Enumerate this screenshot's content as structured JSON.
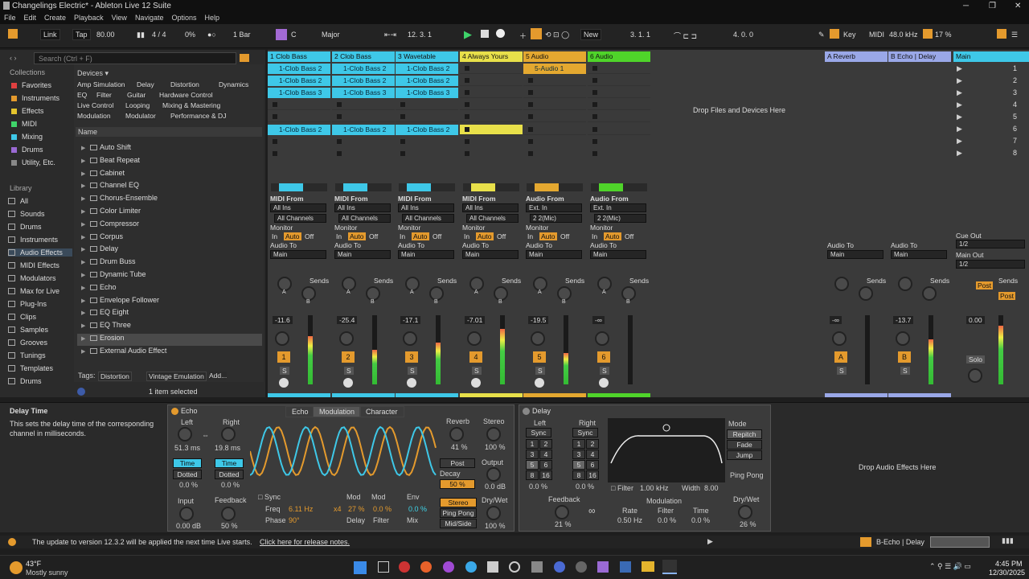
{
  "window": {
    "title": "Changelings Electric* - Ableton Live 12 Suite",
    "min": "─",
    "max": "❐",
    "close": "✕"
  },
  "menu": [
    "File",
    "Edit",
    "Create",
    "Playback",
    "View",
    "Navigate",
    "Options",
    "Help"
  ],
  "transport": {
    "link": "Link",
    "tap": "Tap",
    "tempo": "80.00",
    "sig": "4 / 4",
    "groove": "0%",
    "quant": "1 Bar",
    "key": "C",
    "scale": "Major",
    "position": "12.  3.  1",
    "new": "New",
    "loop_start": "3.  1.  1",
    "loop_len": "4.  0.  0",
    "key_btn": "Key",
    "midi_btn": "MIDI",
    "sample_rate": "48.0 kHz",
    "cpu": "17 %"
  },
  "browser": {
    "search_placeholder": "Search (Ctrl + F)",
    "collections_h": "Collections",
    "collections": [
      {
        "label": "Favorites",
        "color": "#e04040"
      },
      {
        "label": "Instruments",
        "color": "#e49a2d"
      },
      {
        "label": "Effects",
        "color": "#e4c42d"
      },
      {
        "label": "MIDI",
        "color": "#3fd46a"
      },
      {
        "label": "Mixing",
        "color": "#3ec8e8"
      },
      {
        "label": "Drums",
        "color": "#9a6ad4"
      },
      {
        "label": "Utility, Etc.",
        "color": "#888888"
      }
    ],
    "library_h": "Library",
    "library": [
      "All",
      "Sounds",
      "Drums",
      "Instruments",
      "Audio Effects",
      "MIDI Effects",
      "Modulators",
      "Max for Live",
      "Plug-Ins",
      "Clips",
      "Samples",
      "Grooves",
      "Tunings",
      "Templates",
      "Drums"
    ],
    "devices_h": "Devices",
    "device_tags": [
      "Amp Simulation",
      "Delay",
      "Distortion",
      "Dynamics",
      "EQ",
      "Filter",
      "Guitar",
      "Hardware Control",
      "Live Control",
      "Looping",
      "Mixing & Mastering",
      "Modulation",
      "Modulator",
      "Performance & DJ"
    ],
    "name_h": "Name",
    "files": [
      "Auto Shift",
      "Beat Repeat",
      "Cabinet",
      "Channel EQ",
      "Chorus-Ensemble",
      "Color Limiter",
      "Compressor",
      "Corpus",
      "Delay",
      "Drum Buss",
      "Dynamic Tube",
      "Echo",
      "Envelope Follower",
      "EQ Eight",
      "EQ Three",
      "Erosion",
      "External Audio Effect"
    ],
    "tags_label": "Tags:",
    "tags": [
      "Distortion",
      "Vintage Emulation",
      "Add..."
    ],
    "status": "1 item selected"
  },
  "tracks": [
    {
      "name": "1 Clob Bass",
      "color": "#3ec8e8",
      "clips": [
        "1-Clob Bass 2",
        "1-Clob Bass 2",
        "1-Clob Bass 3",
        "",
        "",
        "1-Clob Bass 2"
      ],
      "in_label": "MIDI From",
      "in1": "All Ins",
      "in2": "All Channels",
      "vol": "-11.6",
      "num": "1"
    },
    {
      "name": "2 Clob Bass",
      "color": "#3ec8e8",
      "clips": [
        "1-Clob Bass 2",
        "1-Clob Bass 2",
        "1-Clob Bass 3",
        "",
        "",
        "1-Clob Bass 2"
      ],
      "in_label": "MIDI From",
      "in1": "All Ins",
      "in2": "All Channels",
      "vol": "-25.4",
      "num": "2"
    },
    {
      "name": "3 Wavetable",
      "color": "#3ec8e8",
      "clips": [
        "1-Clob Bass 2",
        "1-Clob Bass 2",
        "1-Clob Bass 3",
        "",
        "",
        "1-Clob Bass 2"
      ],
      "in_label": "MIDI From",
      "in1": "All Ins",
      "in2": "All Channels",
      "vol": "-17.1",
      "num": "3"
    },
    {
      "name": "4 Always Yours",
      "color": "#e8e04a",
      "clips": [
        "",
        "",
        "",
        "",
        "",
        ""
      ],
      "in_label": "MIDI From",
      "in1": "All Ins",
      "in2": "All Channels",
      "vol": "-7.01",
      "num": "4"
    },
    {
      "name": "5 Audio",
      "color": "#e4a830",
      "clips": [
        "5-Audio 1",
        "",
        "",
        "",
        "",
        ""
      ],
      "in_label": "Audio From",
      "in1": "Ext. In",
      "in2": "2 2(Mic)",
      "vol": "-19.5",
      "num": "5"
    },
    {
      "name": "6 Audio",
      "color": "#4fd42a",
      "clips": [
        "",
        "",
        "",
        "",
        "",
        ""
      ],
      "in_label": "Audio From",
      "in1": "Ext. In",
      "in2": "2 2(Mic)",
      "vol": "-∞",
      "num": "6"
    }
  ],
  "mixer": {
    "monitor": "Monitor",
    "in": "In",
    "auto": "Auto",
    "off": "Off",
    "audio_to": "Audio To",
    "main": "Main",
    "sends": "Sends",
    "a": "A",
    "b": "B",
    "s": "S"
  },
  "drop_files": "Drop Files and Devices Here",
  "returns": [
    {
      "name": "A Reverb",
      "vol": "-∞",
      "num": "A"
    },
    {
      "name": "B Echo | Delay",
      "vol": "-13.7",
      "num": "B"
    }
  ],
  "master": {
    "name": "Main",
    "scenes": [
      "1",
      "2",
      "3",
      "4",
      "5",
      "6",
      "7",
      "8"
    ],
    "cue_out": "Cue Out",
    "cue_val": "1/2",
    "main_out": "Main Out",
    "main_val": "1/2",
    "vol": "0.00",
    "post": "Post",
    "solo": "Solo"
  },
  "info": {
    "title": "Delay Time",
    "text": "This sets the delay time of the corresponding channel in milliseconds."
  },
  "echo": {
    "title": "Echo",
    "left": "Left",
    "right": "Right",
    "left_ms": "51.3 ms",
    "right_ms": "19.8 ms",
    "time": "Time",
    "dotted": "Dotted",
    "zero": "0.0 %",
    "input": "Input",
    "input_val": "0.00 dB",
    "feedback": "Feedback",
    "fb_val": "50 %",
    "tabs": [
      "Echo",
      "Modulation",
      "Character"
    ],
    "sync": "Sync",
    "freq": "Freq",
    "freq_val": "6.11 Hz",
    "x4": "x4",
    "phase": "Phase",
    "phase_val": "90°",
    "mod": "Mod",
    "env": "Env",
    "mod1": "27 %",
    "mod2": "0.0 %",
    "env_val": "0.0 %",
    "delay": "Delay",
    "filter": "Filter",
    "mix": "Mix",
    "reverb": "Reverb",
    "reverb_val": "41 %",
    "stereo": "Stereo",
    "stereo_val": "100 %",
    "post": "Post",
    "decay": "Decay",
    "decay_val": "50 %",
    "output": "Output",
    "output_val": "0.0 dB",
    "stereo_btn": "Stereo",
    "pingpong": "Ping Pong",
    "midside": "Mid/Side",
    "drywet": "Dry/Wet",
    "drywet_val": "100 %"
  },
  "delay": {
    "title": "Delay",
    "left": "Left",
    "right": "Right",
    "sync": "Sync",
    "grid": [
      "1",
      "2",
      "3",
      "4",
      "5",
      "6",
      "8",
      "16"
    ],
    "zero": "0.0 %",
    "feedback": "Feedback",
    "fb_val": "21 %",
    "filter": "Filter",
    "filter_val": "1.00 kHz",
    "width": "Width",
    "width_val": "8.00",
    "modulation": "Modulation",
    "rate": "Rate",
    "rate_val": "0.50 Hz",
    "filter2": "Filter",
    "filter2_val": "0.0 %",
    "time": "Time",
    "time_val": "0.0 %",
    "mode": "Mode",
    "modes": [
      "Repitch",
      "Fade",
      "Jump"
    ],
    "pingpong": "Ping Pong",
    "drywet": "Dry/Wet",
    "drywet_val": "26 %",
    "inf": "∞"
  },
  "drop_effects": "Drop Audio Effects Here",
  "status_bar": {
    "msg": "The update to version 12.3.2 will be applied the next time Live starts.",
    "link": "Click here for release notes.",
    "track": "B-Echo | Delay"
  },
  "taskbar": {
    "temp": "43°F",
    "weather": "Mostly sunny",
    "time": "4:45 PM",
    "date": "12/30/2025"
  }
}
